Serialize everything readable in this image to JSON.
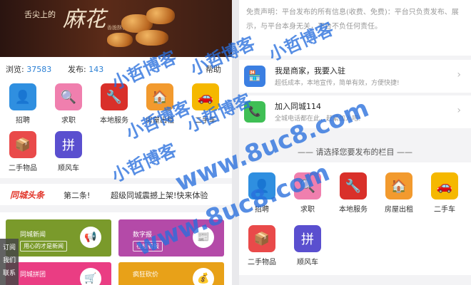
{
  "left": {
    "banner": {
      "small": "舌尖上的",
      "big": "麻花",
      "sub": "香脆酥香 传统工艺"
    },
    "stats": {
      "views_label": "浏览:",
      "views": "37583",
      "posts_label": "发布:",
      "posts": "143",
      "help": "帮助"
    },
    "categories": [
      {
        "label": "招聘",
        "glyph": "👤",
        "color": "#2f8fe0"
      },
      {
        "label": "求职",
        "glyph": "🔍",
        "color": "#f07fae"
      },
      {
        "label": "本地服务",
        "glyph": "🔧",
        "color": "#d9302a"
      },
      {
        "label": "房屋出租",
        "glyph": "🏠",
        "color": "#f29a2e"
      },
      {
        "label": "二手车",
        "glyph": "🚗",
        "color": "#f5b800"
      },
      {
        "label": "二手物品",
        "glyph": "📦",
        "color": "#e94a4a"
      },
      {
        "label": "顺风车",
        "glyph": "拼",
        "color": "#5a4fcf"
      }
    ],
    "ticker": {
      "logo": "同城头条",
      "t1": "第二条!",
      "t2": "超级同城震撼上架!快来体验"
    },
    "cards": [
      {
        "title": "同城新闻",
        "sub": "用心的才是新闻",
        "color": "#7a9a2b",
        "glyph": "📢"
      },
      {
        "title": "数字报",
        "sub": "在线看报",
        "color": "#b44aa8",
        "glyph": "📰"
      },
      {
        "title": "同城拼团",
        "sub": "",
        "color": "#ea3d83",
        "glyph": "🛒"
      },
      {
        "title": "疯狂砍价",
        "sub": "",
        "color": "#e8a118",
        "glyph": "💰"
      }
    ],
    "float_menu": [
      "订阅",
      "我们",
      "联系"
    ]
  },
  "right": {
    "disclaimer": "免责声明：平台发布的所有信息(收费、免费)：平台只负责发布、展示，与平台本身无关，平台不负任何责任。",
    "merchant": {
      "title": "我是商家，我要入驻",
      "sub": "超低成本，本地宣传，简单有效，方便快捷!",
      "glyph": "🏪",
      "color": "#3b7fe2"
    },
    "join": {
      "title": "加入同城114",
      "sub": "全城电话都在此，赶紧加入吧!",
      "glyph": "📞",
      "color": "#3fbf55"
    },
    "section_title": "—— 请选择您要发布的栏目 ——",
    "categories": [
      {
        "label": "招聘",
        "glyph": "👤",
        "color": "#2f8fe0"
      },
      {
        "label": "求职",
        "glyph": "🔍",
        "color": "#f07fae"
      },
      {
        "label": "本地服务",
        "glyph": "🔧",
        "color": "#d9302a"
      },
      {
        "label": "房屋出租",
        "glyph": "🏠",
        "color": "#f29a2e"
      },
      {
        "label": "二手车",
        "glyph": "🚗",
        "color": "#f5b800"
      },
      {
        "label": "二手物品",
        "glyph": "📦",
        "color": "#e94a4a"
      },
      {
        "label": "顺风车",
        "glyph": "拼",
        "color": "#5a4fcf"
      }
    ]
  },
  "watermark": {
    "cn": "小哲博客",
    "url": "www.8uc8.com"
  }
}
